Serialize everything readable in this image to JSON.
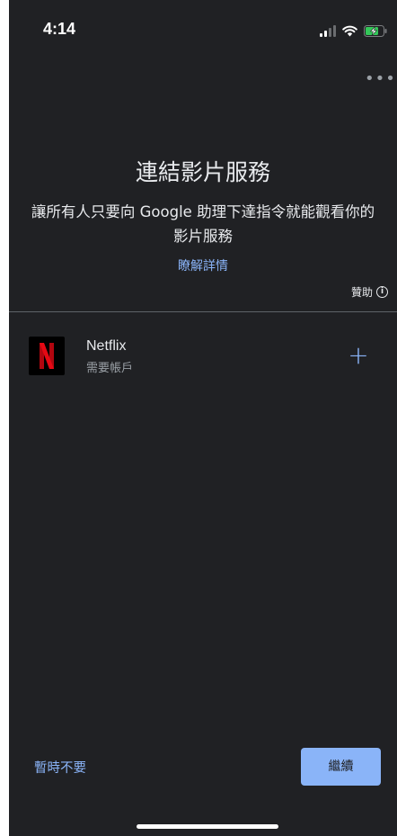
{
  "status_bar": {
    "time": "4:14"
  },
  "header": {
    "title": "連結影片服務",
    "subtitle": "讓所有人只要向 Google 助理下達指令就能觀看你的影片服務",
    "learn_more": "瞭解詳情",
    "sponsored": "贊助"
  },
  "services": [
    {
      "name": "Netflix",
      "note": "需要帳戶",
      "logo_letter": "N",
      "logo_color": "#e50914",
      "action_icon": "+"
    }
  ],
  "footer": {
    "not_now": "暫時不要",
    "continue": "繼續"
  },
  "colors": {
    "background": "#202124",
    "accent": "#8ab4f8",
    "text_primary": "#e8eaed",
    "text_secondary": "#9aa0a6"
  }
}
